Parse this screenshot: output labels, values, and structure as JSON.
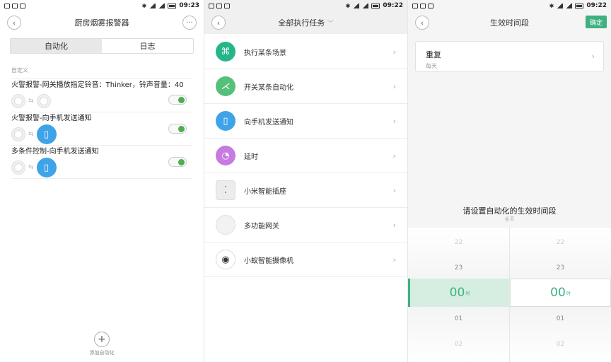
{
  "screen1": {
    "status_time": "09:23",
    "title": "厨房烟雾报警器",
    "tabs": [
      "自动化",
      "日志"
    ],
    "section_label": "自定义",
    "automations": [
      {
        "title": "火警报警-网关播放指定铃音：Thinker，铃声音量：40"
      },
      {
        "title": "火警报警-向手机发送通知"
      },
      {
        "title": "多条件控制-向手机发送通知"
      }
    ],
    "add_label": "添加自动化"
  },
  "screen2": {
    "status_time": "09:22",
    "title": "全部执行任务",
    "tasks": [
      {
        "label": "执行某条场景",
        "icon": "scene-icon",
        "color": "#26b58a"
      },
      {
        "label": "开关某条自动化",
        "icon": "automation-icon",
        "color": "#56c07a"
      },
      {
        "label": "向手机发送通知",
        "icon": "phone-icon",
        "color": "#3fa3e8"
      },
      {
        "label": "延时",
        "icon": "clock-icon",
        "color": "#c77ae0"
      },
      {
        "label": "小米智能插座",
        "icon": "plug-icon",
        "color": "#e8e8e8"
      },
      {
        "label": "多功能网关",
        "icon": "gateway-icon",
        "color": "#eeeeee"
      },
      {
        "label": "小蚁智能摄像机",
        "icon": "camera-icon",
        "color": "#ffffff"
      }
    ]
  },
  "screen3": {
    "status_time": "09:22",
    "title": "生效时间段",
    "confirm_label": "确定",
    "repeat_label": "重复",
    "repeat_value": "每天",
    "picker_title": "请设置自动化的生效时间段",
    "picker_sub": "全天",
    "left": {
      "above2": "22",
      "above1": "23",
      "value": "00",
      "unit": "时",
      "below1": "01",
      "below2": "02"
    },
    "right": {
      "above2": "22",
      "above1": "23",
      "value": "00",
      "unit": "时",
      "below1": "01",
      "below2": "02"
    }
  }
}
